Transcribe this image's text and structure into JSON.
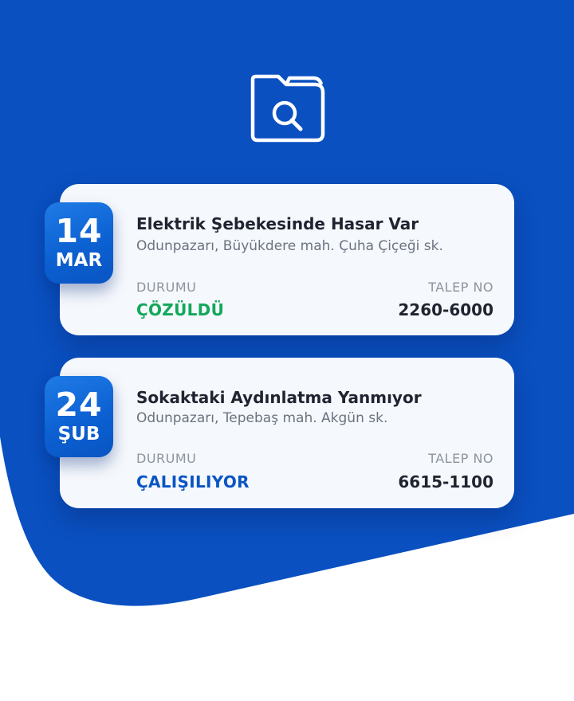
{
  "theme": {
    "primary_blue": "#0a50c0",
    "resolved_green": "#12a85a",
    "working_blue": "#0a55c4"
  },
  "hero": {
    "icon": "folder-search-icon"
  },
  "requests": [
    {
      "day": "14",
      "month": "MAR",
      "title": "Elektrik Şebekesinde Hasar Var",
      "address": "Odunpazarı, Büyükdere mah. Çuha Çiçeği sk.",
      "status_label": "DURUMU",
      "status": "ÇÖZÜLDÜ",
      "status_color": "#12a85a",
      "request_label": "TALEP NO",
      "request_no": "2260-6000"
    },
    {
      "day": "24",
      "month": "ŞUB",
      "title": "Sokaktaki Aydınlatma Yanmıyor",
      "address": "Odunpazarı, Tepebaş mah. Akgün sk.",
      "status_label": "DURUMU",
      "status": "ÇALIŞILIYOR",
      "status_color": "#0a55c4",
      "request_label": "TALEP NO",
      "request_no": "6615-1100"
    }
  ]
}
